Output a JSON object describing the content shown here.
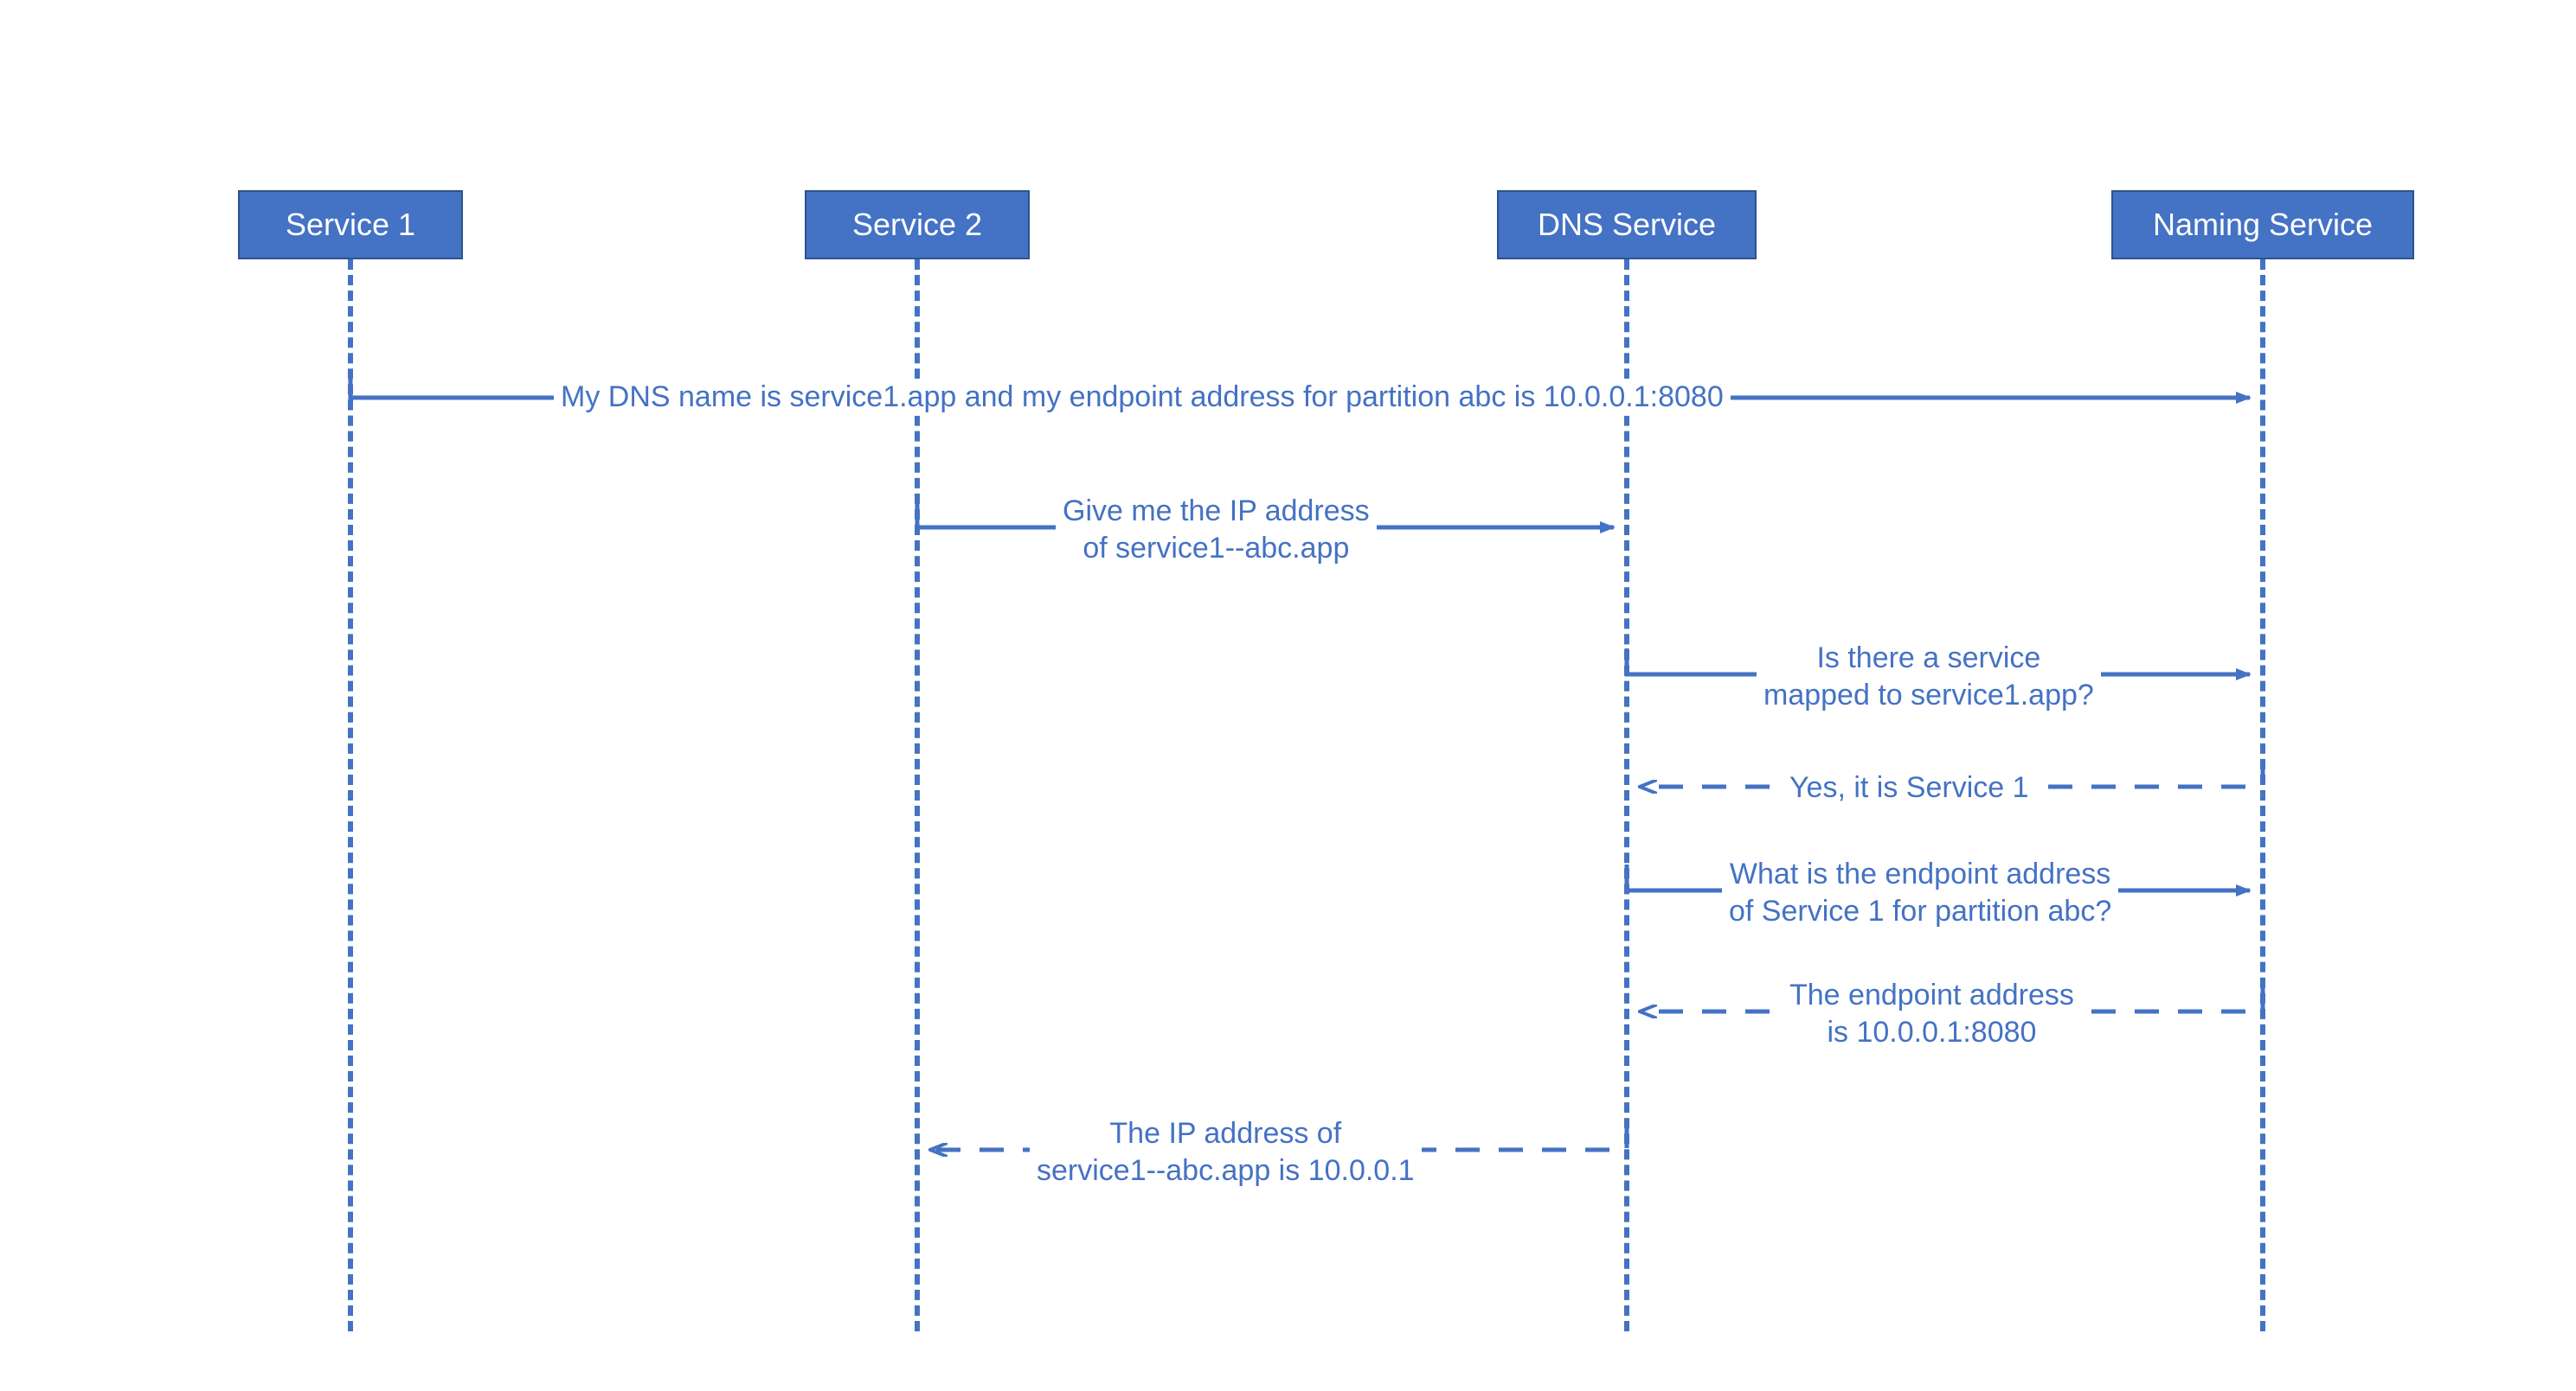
{
  "colors": {
    "blue": "#4472C4",
    "blueDark": "#2F528F",
    "white": "#FFFFFF"
  },
  "participants": {
    "p1": "Service 1",
    "p2": "Service 2",
    "p3": "DNS Service",
    "p4": "Naming Service"
  },
  "messages": {
    "m1": "My DNS name is service1.app and my endpoint address for partition abc is 10.0.0.1:8080",
    "m2_l1": "Give me the IP address",
    "m2_l2": "of service1--abc.app",
    "m3_l1": "Is there a service",
    "m3_l2": "mapped to service1.app?",
    "m4": "Yes, it is Service 1",
    "m5_l1": "What is the endpoint address",
    "m5_l2": "of Service 1 for partition abc?",
    "m6_l1": "The endpoint address",
    "m6_l2": "is 10.0.0.1:8080",
    "m7_l1": "The IP address of",
    "m7_l2": "service1--abc.app is 10.0.0.1"
  }
}
